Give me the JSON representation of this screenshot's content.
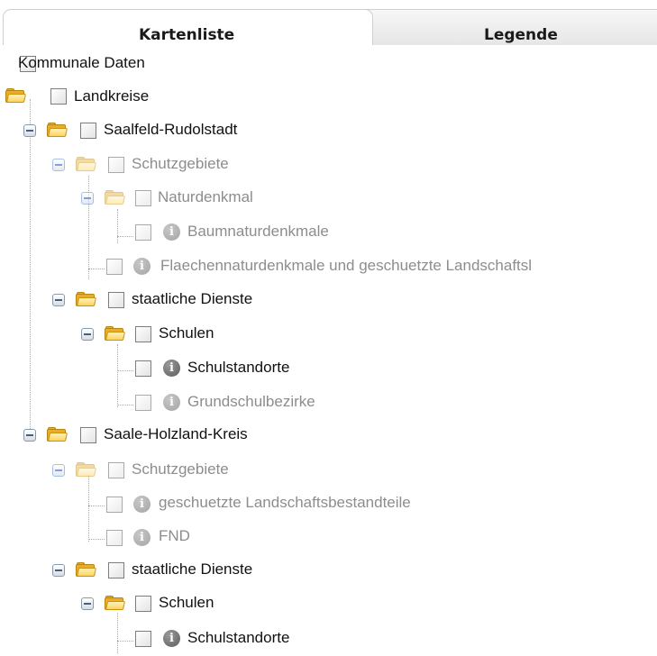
{
  "tabs": [
    {
      "label": "Kartenliste",
      "active": true
    },
    {
      "label": "Legende",
      "active": false
    }
  ],
  "icons": {
    "checkbox": "checkbox-icon",
    "folder": "folder-open-icon",
    "collapse": "collapse-minus-icon",
    "info": "info-icon"
  },
  "colors": {
    "text": "#111111",
    "dimmed_text": "#8d8d8d",
    "folder": "#e9ad2a",
    "tree_line": "#aaaaaa"
  },
  "tree": {
    "nodes": [
      {
        "label": "Kommunale Daten",
        "dimmed": false
      },
      {
        "label": "Landkreise",
        "dimmed": false
      },
      {
        "label": "Saalfeld-Rudolstadt",
        "dimmed": false
      },
      {
        "label": "Schutzgebiete",
        "dimmed": true
      },
      {
        "label": "Naturdenkmal",
        "dimmed": true
      },
      {
        "label": "Baumnaturdenkmale",
        "dimmed": true
      },
      {
        "label": "Flaechennaturdenkmale und geschuetzte Landschaftsl",
        "dimmed": true
      },
      {
        "label": "staatliche Dienste",
        "dimmed": false
      },
      {
        "label": "Schulen",
        "dimmed": false
      },
      {
        "label": "Schulstandorte",
        "dimmed": false
      },
      {
        "label": "Grundschulbezirke",
        "dimmed": true
      },
      {
        "label": "Saale-Holzland-Kreis",
        "dimmed": false
      },
      {
        "label": "Schutzgebiete",
        "dimmed": true
      },
      {
        "label": "geschuetzte Landschaftsbestandteile",
        "dimmed": true
      },
      {
        "label": "FND",
        "dimmed": true
      },
      {
        "label": "staatliche Dienste",
        "dimmed": false
      },
      {
        "label": "Schulen",
        "dimmed": false
      },
      {
        "label": "Schulstandorte",
        "dimmed": false
      }
    ]
  }
}
